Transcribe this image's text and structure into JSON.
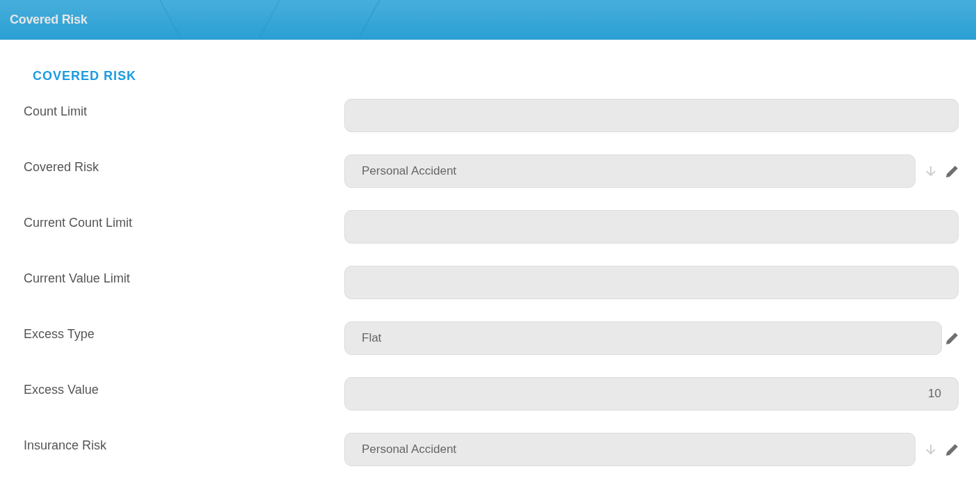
{
  "window": {
    "title": "Covered Risk"
  },
  "section": {
    "title": "COVERED RISK"
  },
  "fields": [
    {
      "label": "Count Limit",
      "kind": "text"
    },
    {
      "label": "Covered Risk",
      "kind": "lookup",
      "value": "Personal Accident"
    },
    {
      "label": "Current Count Limit",
      "kind": "text"
    },
    {
      "label": "Current Value Limit",
      "kind": "text"
    },
    {
      "label": "Excess Type",
      "kind": "select",
      "value": "Flat"
    },
    {
      "label": "Excess Value",
      "kind": "number",
      "value": "10"
    },
    {
      "label": "Insurance Risk",
      "kind": "lookup",
      "value": "Personal Accident"
    }
  ]
}
